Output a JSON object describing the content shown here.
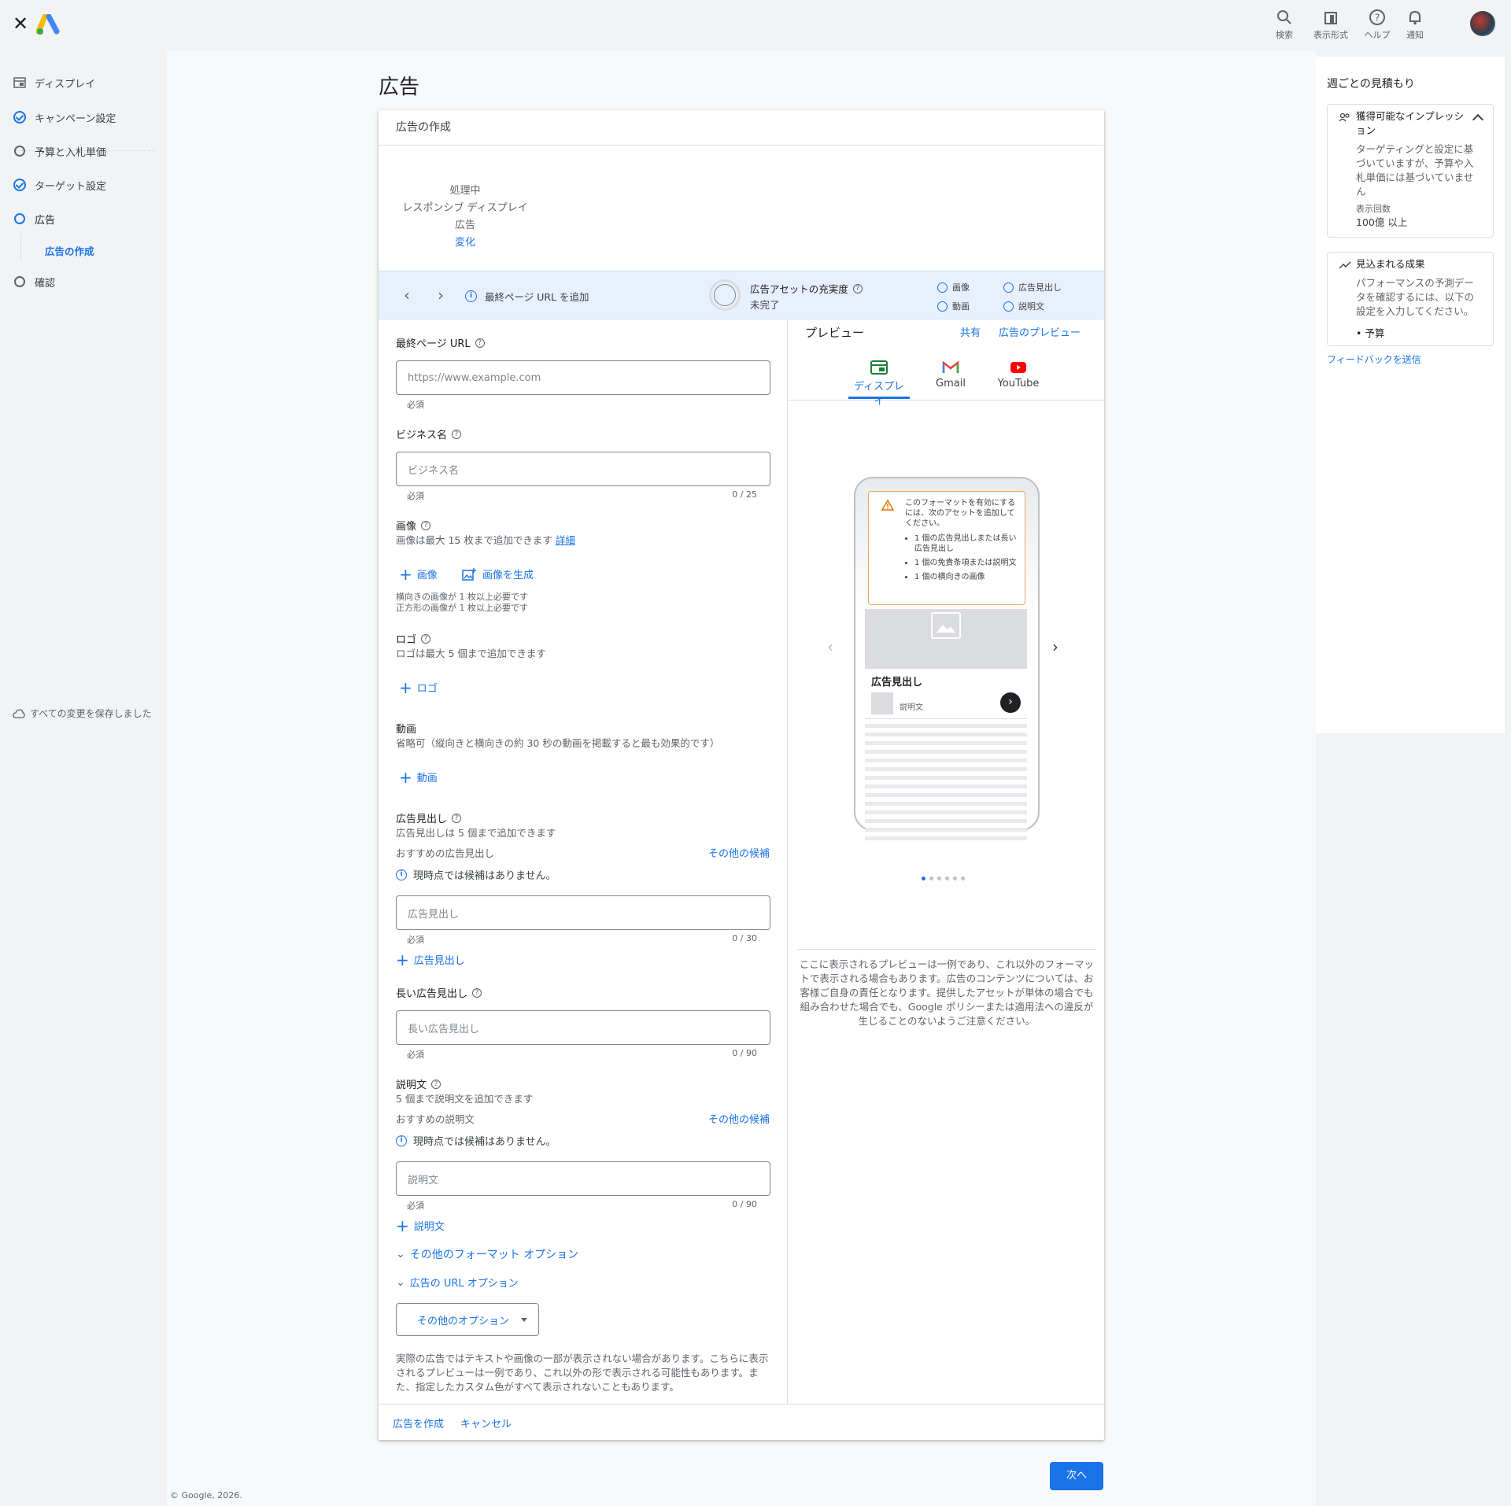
{
  "topbar": {
    "items": [
      {
        "label": "検索",
        "icon": "search-icon"
      },
      {
        "label": "表示形式",
        "icon": "layout-icon"
      },
      {
        "label": "ヘルプ",
        "icon": "help-icon"
      },
      {
        "label": "通知",
        "icon": "bell-icon"
      }
    ]
  },
  "nav": {
    "items": [
      {
        "label": "ディスプレイ"
      },
      {
        "label": "キャンペーン設定"
      },
      {
        "label": "予算と入札単価"
      },
      {
        "label": "ターゲット設定"
      },
      {
        "label": "広告"
      },
      {
        "label": "広告の作成"
      },
      {
        "label": "確認"
      }
    ],
    "saved": "すべての変更を保存しました"
  },
  "page": {
    "title": "広告"
  },
  "card": {
    "title": "広告の作成",
    "status": {
      "line1": "処理中",
      "line2": "レスポンシブ ディスプレイ広告",
      "change": "変化"
    },
    "assetbar": {
      "tip": "最終ページ URL を追加",
      "strength_label": "広告アセットの充実度",
      "strength_value": "未完了",
      "checks": [
        "画像",
        "広告見出し",
        "動画",
        "説明文"
      ]
    }
  },
  "form": {
    "final_url": {
      "label": "最終ページ URL",
      "placeholder": "https://www.example.com",
      "hint": "必須"
    },
    "business": {
      "label": "ビジネス名",
      "placeholder": "ビジネス名",
      "hint": "必須",
      "count": "0 / 25"
    },
    "images": {
      "label": "画像",
      "sub": "画像は最大 15 枚まで追加できます",
      "detail": "詳細",
      "add": "画像",
      "generate": "画像を生成",
      "req1": "横向きの画像が 1 枚以上必要です",
      "req2": "正方形の画像が 1 枚以上必要です"
    },
    "logo": {
      "label": "ロゴ",
      "sub": "ロゴは最大 5 個まで追加できます",
      "add": "ロゴ"
    },
    "video": {
      "label": "動画",
      "sub": "省略可（縦向きと横向きの約 30 秒の動画を掲載すると最も効果的です）",
      "add": "動画"
    },
    "headline": {
      "label": "広告見出し",
      "sub": "広告見出しは 5 個まで追加できます",
      "recommended": "おすすめの広告見出し",
      "more": "その他の候補",
      "none": "現時点では候補はありません。",
      "placeholder": "広告見出し",
      "hint": "必須",
      "count": "0 / 30",
      "add": "広告見出し"
    },
    "long_headline": {
      "label": "長い広告見出し",
      "placeholder": "長い広告見出し",
      "hint": "必須",
      "count": "0 / 90"
    },
    "description": {
      "label": "説明文",
      "sub": "5 個まで説明文を追加できます",
      "recommended": "おすすめの説明文",
      "more": "その他の候補",
      "none": "現時点では候補はありません。",
      "placeholder": "説明文",
      "hint": "必須",
      "count": "0 / 90",
      "add": "説明文"
    },
    "more_formats": "その他のフォーマット オプション",
    "url_options": "広告の URL オプション",
    "other_options": "その他のオプション",
    "disclaimer": "実際の広告ではテキストや画像の一部が表示されない場合があります。こちらに表示されるプレビューは一例であり、これ以外の形で表示される可能性もあります。また、指定したカスタム色がすべて表示されないこともあります。"
  },
  "preview": {
    "title": "プレビュー",
    "share": "共有",
    "preview_link": "広告のプレビュー",
    "tabs": [
      {
        "label": "ディスプレイ"
      },
      {
        "label": "Gmail"
      },
      {
        "label": "YouTube"
      }
    ],
    "warning": {
      "title": "このフォーマットを有効にするには、次のアセットを追加してください。",
      "items": [
        "1 個の広告見出しまたは長い広告見出し",
        "1 個の免責条項または説明文",
        "1 個の横向きの画像"
      ]
    },
    "ad_headline": "広告見出し",
    "ad_description": "説明文",
    "note": "ここに表示されるプレビューは一例であり、これ以外のフォーマットで表示される場合もあります。広告のコンテンツについては、お客様ご自身の責任となります。提供したアセットが単体の場合でも組み合わせた場合でも、Google ポリシーまたは適用法への違反が生じることのないようご注意ください。"
  },
  "footer": {
    "create": "広告を作成",
    "cancel": "キャンセル",
    "next": "次へ",
    "copyright": "© Google, 2026."
  },
  "right": {
    "title": "週ごとの見積もり",
    "impressions": {
      "title": "獲得可能なインプレッション",
      "text": "ターゲティングと設定に基づいていますが、予算や入札単価には基づいていません",
      "count_label": "表示回数",
      "count": "100億 以上"
    },
    "results": {
      "title": "見込まれる成果",
      "text": "パフォーマンスの予測データを確認するには、以下の設定を入力してください。",
      "item": "予算"
    },
    "feedback": "フィードバックを送信"
  },
  "colors": {
    "accent": "#1a73e8",
    "warning": "#e8a465"
  }
}
